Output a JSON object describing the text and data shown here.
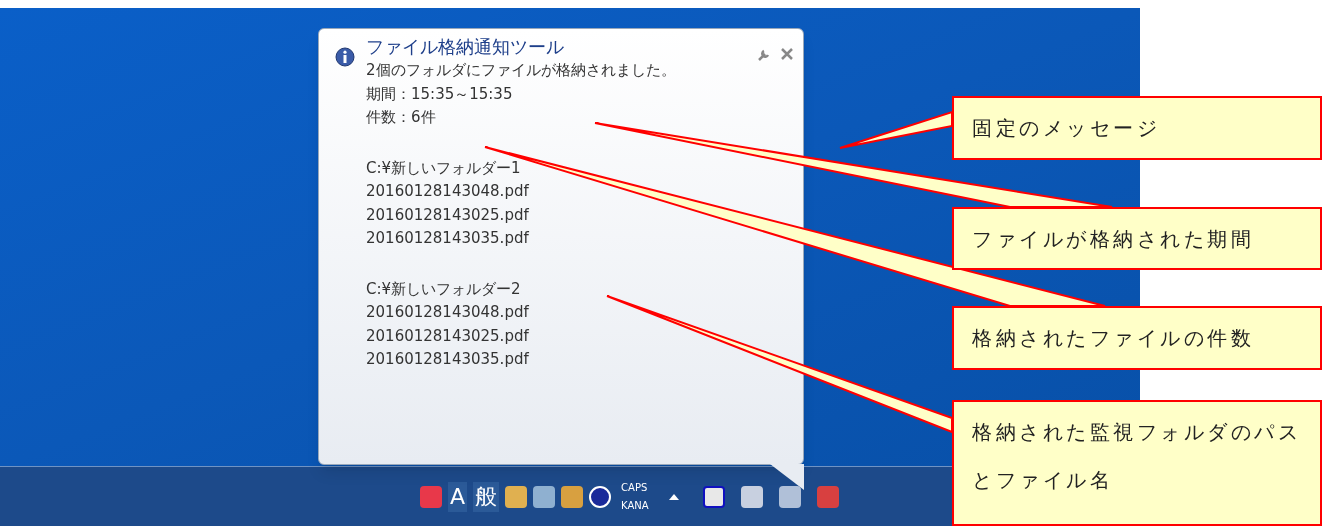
{
  "balloon": {
    "title": "ファイル格納通知ツール",
    "message": "2個のフォルダにファイルが格納されました。",
    "period": "期間：15:35～15:35",
    "count": "件数：6件",
    "folders": [
      {
        "path": "C:¥新しいフォルダー1",
        "files": [
          "20160128143048.pdf",
          "20160128143025.pdf",
          "20160128143035.pdf"
        ]
      },
      {
        "path": "C:¥新しいフォルダー2",
        "files": [
          "20160128143048.pdf",
          "20160128143025.pdf",
          "20160128143035.pdf"
        ]
      }
    ]
  },
  "taskbar": {
    "ime": [
      "A",
      "般"
    ],
    "indicators": [
      "CAPS",
      "KANA"
    ]
  },
  "callouts": [
    {
      "text": "固定のメッセージ"
    },
    {
      "text": "ファイルが格納された期間"
    },
    {
      "text": "格納されたファイルの件数"
    },
    {
      "text": "格納された監視フォルダのパスとファイル名"
    }
  ]
}
